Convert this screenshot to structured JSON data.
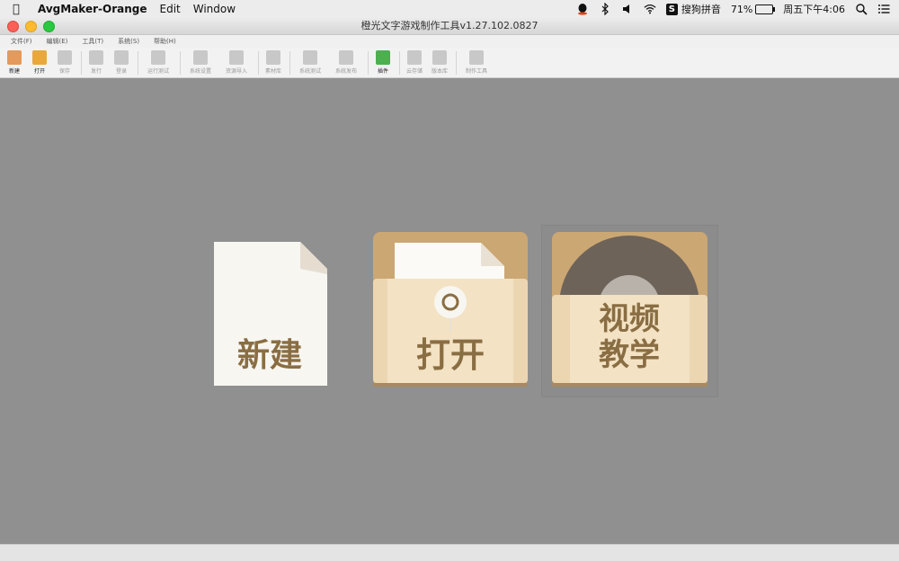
{
  "system_menubar": {
    "app_name": "AvgMaker-Orange",
    "menus": [
      "Edit",
      "Window"
    ],
    "input_method": "搜狗拼音",
    "battery": "71%",
    "clock": "周五下午4:06"
  },
  "window": {
    "title": "橙光文字游戏制作工具v1.27.102.0827"
  },
  "app_menu": [
    "文件(F)",
    "编辑(E)",
    "工具(T)",
    "系统(S)",
    "帮助(H)"
  ],
  "toolbar": [
    {
      "label": "新建",
      "icon": "new-file-icon",
      "active": true,
      "color": "#e39a5a"
    },
    {
      "label": "打开",
      "icon": "open-folder-icon",
      "active": true,
      "color": "#e8a83a"
    },
    {
      "label": "保存",
      "icon": "save-icon",
      "active": false,
      "color": "#c8c8c8"
    },
    {
      "label": "发行",
      "icon": "publish-icon",
      "active": false,
      "color": "#c8c8c8"
    },
    {
      "label": "登录",
      "icon": "login-icon",
      "active": false,
      "color": "#c8c8c8"
    },
    {
      "label": "运行测试",
      "icon": "run-test-icon",
      "active": false,
      "color": "#c8c8c8"
    },
    {
      "label": "系统设置",
      "icon": "settings-icon",
      "active": false,
      "color": "#c8c8c8"
    },
    {
      "label": "资源导入",
      "icon": "import-icon",
      "active": false,
      "color": "#c8c8c8"
    },
    {
      "label": "素材库",
      "icon": "material-icon",
      "active": false,
      "color": "#c8c8c8"
    },
    {
      "label": "系统测试",
      "icon": "system-test-icon",
      "active": false,
      "color": "#c8c8c8"
    },
    {
      "label": "系统发布",
      "icon": "system-publish-icon",
      "active": false,
      "color": "#c8c8c8"
    },
    {
      "label": "插件",
      "icon": "plugin-icon",
      "active": true,
      "color": "#4caf50"
    },
    {
      "label": "云存储",
      "icon": "cloud-icon",
      "active": false,
      "color": "#c8c8c8"
    },
    {
      "label": "版本库",
      "icon": "version-icon",
      "active": false,
      "color": "#c8c8c8"
    },
    {
      "label": "制作工具",
      "icon": "tools-icon",
      "active": false,
      "color": "#c8c8c8"
    }
  ],
  "tiles": {
    "new_label": "新建",
    "open_label": "打开",
    "video_label_line1": "视频",
    "video_label_line2": "教学"
  },
  "colors": {
    "tile_tan": "#e6cfa8",
    "tile_dark": "#c9a574",
    "label_brown": "#8a6e43",
    "canvas_gray": "#909090"
  }
}
